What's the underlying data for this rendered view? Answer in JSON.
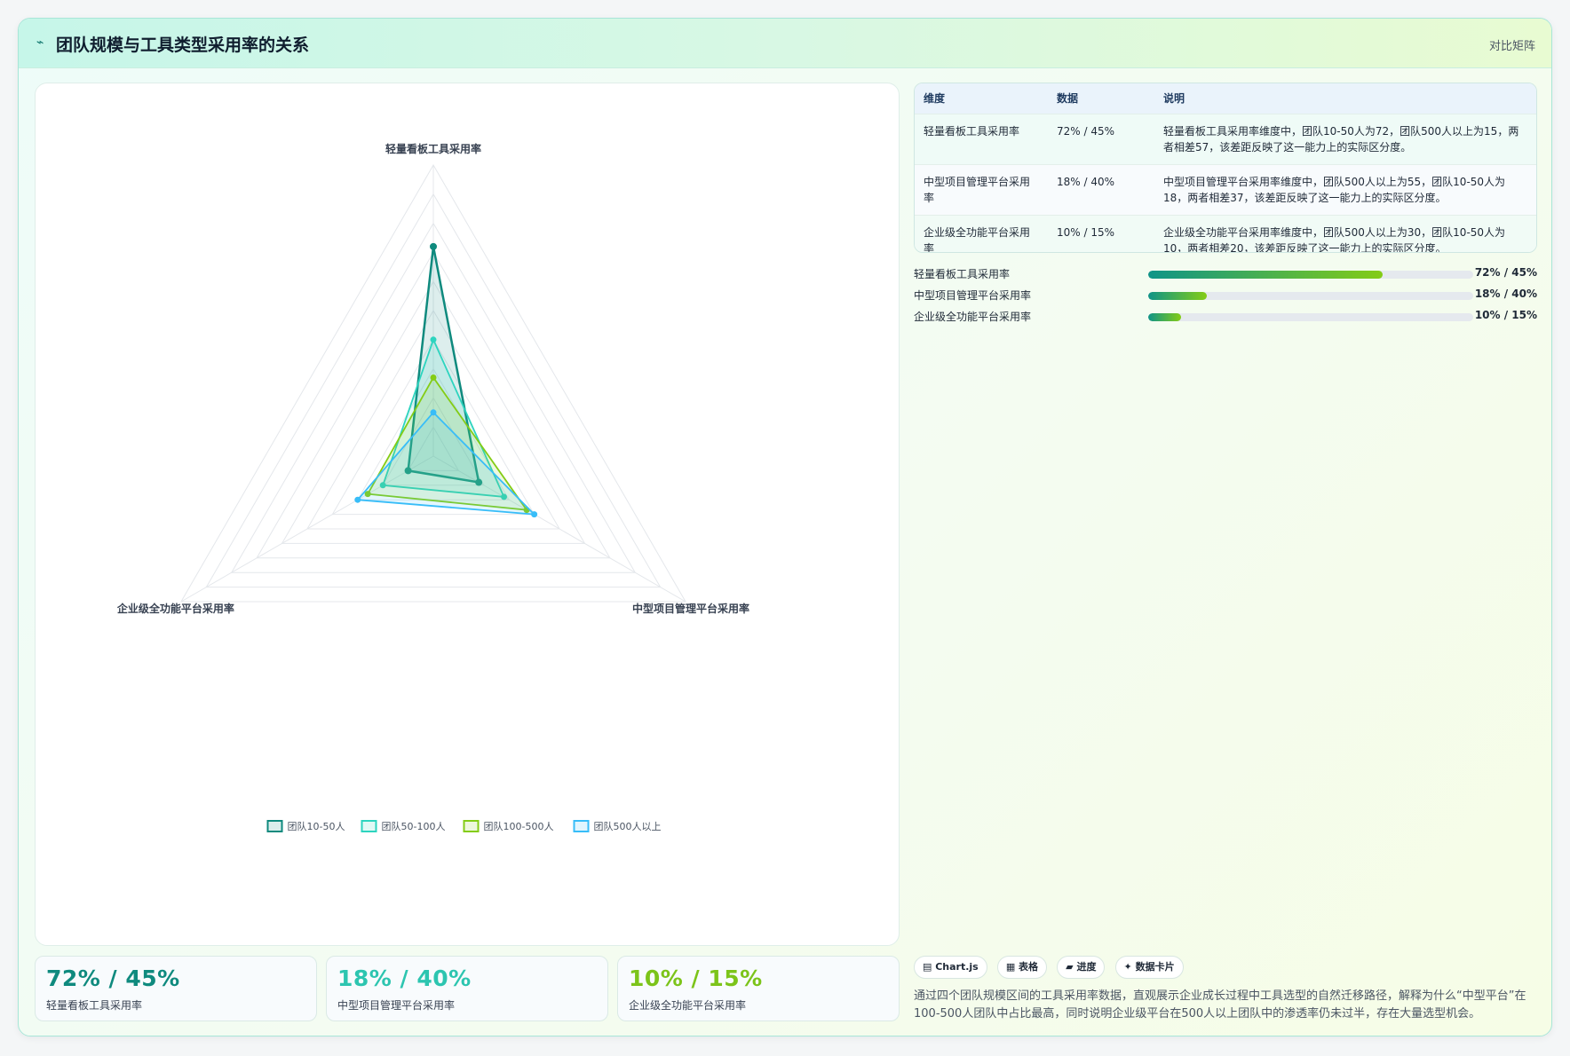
{
  "header": {
    "logo": "⌁",
    "title": "团队规模与工具类型采用率的关系",
    "tag": "对比矩阵"
  },
  "chart_data": {
    "type": "radar",
    "axes": [
      "轻量看板工具采用率",
      "中型项目管理平台采用率",
      "企业级全功能平台采用率"
    ],
    "rmax": 100,
    "grid_levels": 10,
    "series": [
      {
        "name": "团队10-50人",
        "values": [
          72,
          18,
          10
        ],
        "color": "#0f8a7e"
      },
      {
        "name": "团队50-100人",
        "values": [
          40,
          28,
          20
        ],
        "color": "#2dd4bf"
      },
      {
        "name": "团队100-500人",
        "values": [
          27,
          37,
          26
        ],
        "color": "#84cc16"
      },
      {
        "name": "团队500人以上",
        "values": [
          15,
          40,
          30
        ],
        "color": "#38bdf8"
      }
    ],
    "legend_position": "bottom"
  },
  "table": {
    "headers": [
      "维度",
      "数据",
      "说明"
    ],
    "rows": [
      {
        "dim": "轻量看板工具采用率",
        "data": "72% / 45%",
        "note": "轻量看板工具采用率维度中，团队10-50人为72，团队500人以上为15，两者相差57，该差距反映了这一能力上的实际区分度。"
      },
      {
        "dim": "中型项目管理平台采用率",
        "data": "18% / 40%",
        "note": "中型项目管理平台采用率维度中，团队500人以上为55，团队10-50人为18，两者相差37，该差距反映了这一能力上的实际区分度。"
      },
      {
        "dim": "企业级全功能平台采用率",
        "data": "10% / 15%",
        "note": "企业级全功能平台采用率维度中，团队500人以上为30，团队10-50人为10，两者相差20，该差距反映了这一能力上的实际区分度。"
      }
    ]
  },
  "bars": [
    {
      "label": "轻量看板工具采用率",
      "value": "72% / 45%",
      "fill": 0.72
    },
    {
      "label": "中型项目管理平台采用率",
      "value": "18% / 40%",
      "fill": 0.18
    },
    {
      "label": "企业级全功能平台采用率",
      "value": "10% / 15%",
      "fill": 0.1
    }
  ],
  "pills": [
    "▤ Chart.js",
    "▦ 表格",
    "▰ 进度",
    "✦ 数据卡片"
  ],
  "description": "通过四个团队规模区间的工具采用率数据，直观展示企业成长过程中工具选型的自然迁移路径，解释为什么“中型平台”在100-500人团队中占比最高，同时说明企业级平台在500人以上团队中的渗透率仍未过半，存在大量选型机会。",
  "stats": [
    {
      "value": "72% / 45%",
      "label": "轻量看板工具采用率",
      "color": "#0f8a7e"
    },
    {
      "value": "18% / 40%",
      "label": "中型项目管理平台采用率",
      "color": "#2dc5b0"
    },
    {
      "value": "10% / 15%",
      "label": "企业级全功能平台采用率",
      "color": "#7cc41a"
    }
  ]
}
